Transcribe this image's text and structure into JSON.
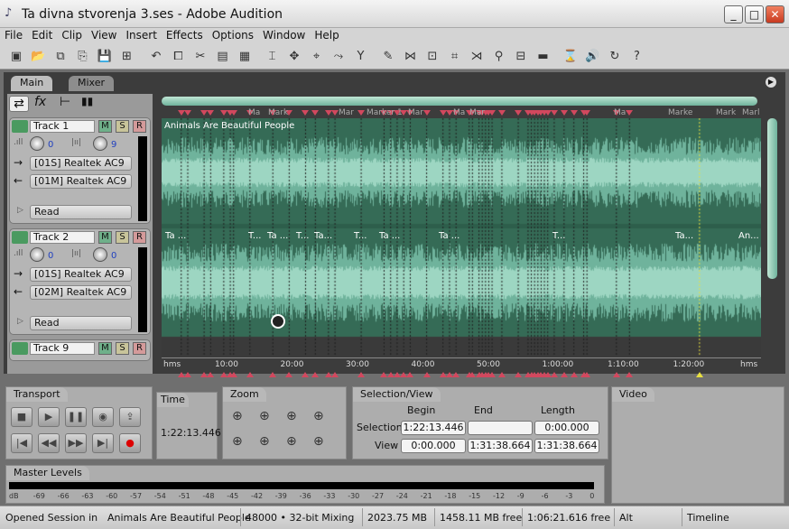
{
  "window": {
    "title": "Ta divna stvorenja 3.ses - Adobe Audition",
    "minimize": "_",
    "maximize": "□",
    "close": "✕"
  },
  "menu": [
    "File",
    "Edit",
    "Clip",
    "View",
    "Insert",
    "Effects",
    "Options",
    "Window",
    "Help"
  ],
  "toolbar_icons": [
    "new-session-icon",
    "open-icon",
    "open-append-icon",
    "save-as-icon",
    "save-icon",
    "save-all-icon",
    "undo-icon",
    "copy-icon",
    "cut-icon",
    "paste-icon",
    "mix-paste-icon",
    "time-selection-tool-icon",
    "move-copy-tool-icon",
    "hybrid-tool-icon",
    "scrub-tool-icon",
    "insert-marker-icon",
    "edit-file-icon",
    "split-icon",
    "group-icon",
    "trim-icon",
    "crossfade-icon",
    "lock-icon",
    "mixdown-icon",
    "video-icon",
    "metronome-icon",
    "speaker-icon",
    "loop-icon",
    "help-icon"
  ],
  "tabs": {
    "main": "Main",
    "mixer": "Mixer"
  },
  "tracks": [
    {
      "name": "Track 1",
      "volume": "0",
      "pan": "9",
      "output": "[01S] Realtek AC9",
      "input": "[01M] Realtek AC9",
      "automation": "Read"
    },
    {
      "name": "Track 2",
      "volume": "0",
      "pan": "0",
      "output": "[01S] Realtek AC9",
      "input": "[02M] Realtek AC9",
      "automation": "Read"
    },
    {
      "name": "Track 9"
    }
  ],
  "msr": {
    "m": "M",
    "s": "S",
    "r": "R"
  },
  "clip_title": "Animals Are Beautiful People",
  "track2_clip_labels": [
    "Ta ...",
    "T...",
    "Ta ...",
    "T...",
    "Ta...",
    "T...",
    "Ta ...",
    "Ta ...",
    "T...",
    "Ta...",
    "An..."
  ],
  "marker_labels": [
    "Ma",
    "Mark",
    "Mar",
    "Marker 1",
    "Mar",
    "Ma",
    "Mar",
    "Ma",
    "Marke",
    "Mark",
    "Marl"
  ],
  "ruler": {
    "unit": "hms",
    "ticks": [
      "10:00",
      "20:00",
      "30:00",
      "40:00",
      "50:00",
      "1:00:00",
      "1:10:00",
      "1:20:00"
    ]
  },
  "transport": {
    "title": "Transport"
  },
  "time": {
    "title": "Time",
    "value": "1:22:13.446"
  },
  "zoom": {
    "title": "Zoom"
  },
  "selection_view": {
    "title": "Selection/View",
    "headers": [
      "Begin",
      "End",
      "Length"
    ],
    "rows": [
      {
        "label": "Selection",
        "begin": "1:22:13.446",
        "end": "",
        "length": "0:00.000"
      },
      {
        "label": "View",
        "begin": "0:00.000",
        "end": "1:31:38.664",
        "length": "1:31:38.664"
      }
    ]
  },
  "video": {
    "title": "Video"
  },
  "master_levels": {
    "title": "Master Levels",
    "scale": [
      "dB",
      "-69",
      "-66",
      "-63",
      "-60",
      "-57",
      "-54",
      "-51",
      "-48",
      "-45",
      "-42",
      "-39",
      "-36",
      "-33",
      "-30",
      "-27",
      "-24",
      "-21",
      "-18",
      "-15",
      "-12",
      "-9",
      "-6",
      "-3",
      "0"
    ]
  },
  "status": [
    "Opened Session in",
    "Animals Are Beautiful People",
    "48000 • 32-bit Mixing",
    "2023.75 MB",
    "1458.11 MB free",
    "1:06:21.616 free",
    "Alt",
    "Timeline"
  ],
  "colors": {
    "clip": "#356b56",
    "wave": "#6fb39c",
    "marker": "#d2485e",
    "cursor": "#e8e040"
  }
}
